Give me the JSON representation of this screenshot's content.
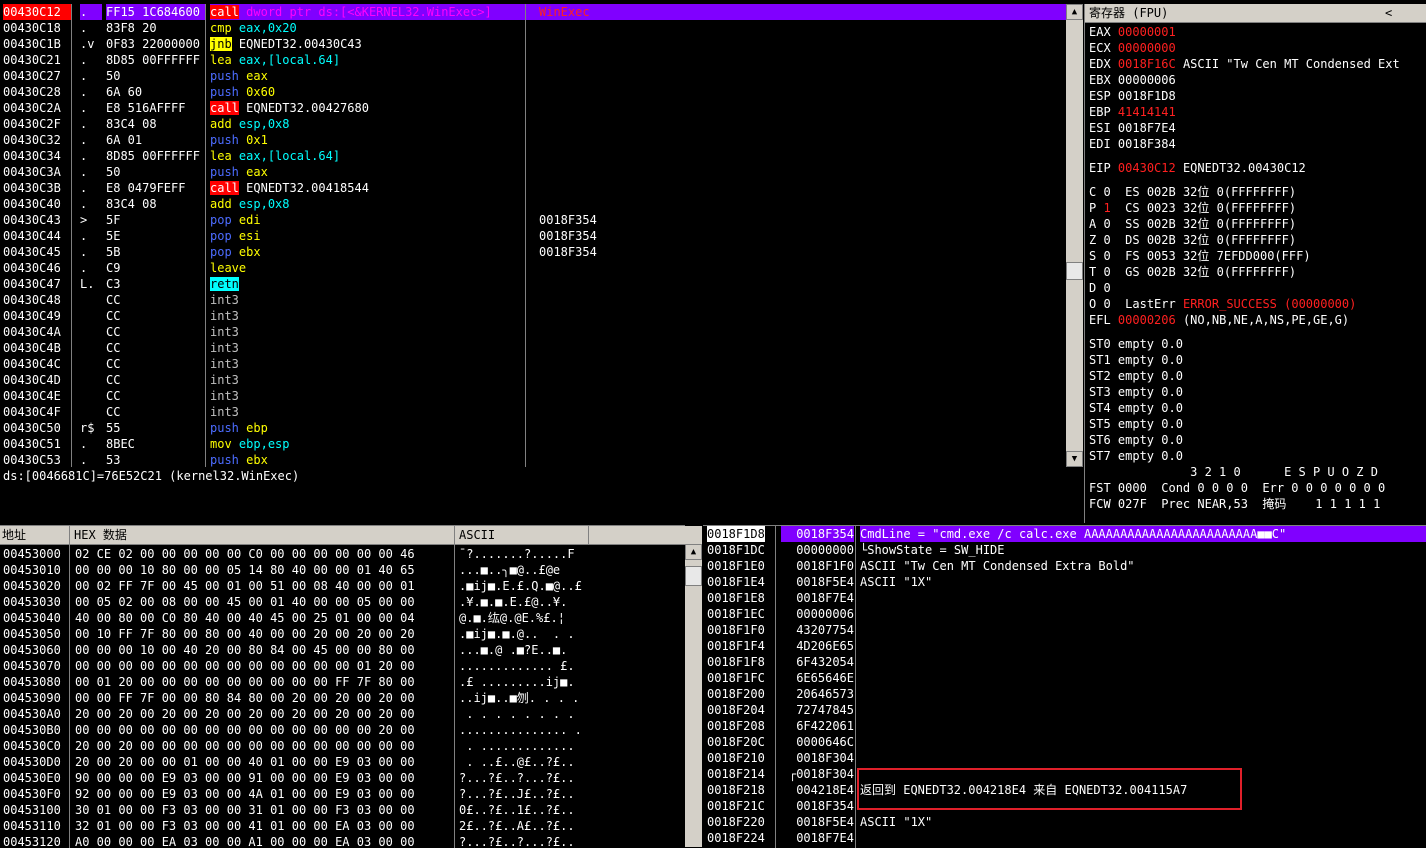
{
  "colors": {
    "select": "#8000ff",
    "call": "#ff0000",
    "jump": "#ffff00",
    "ret": "#00ffff",
    "push": "#4c6cff",
    "annot": "#e0202a"
  },
  "disasm": {
    "rows": [
      {
        "addr": "00430C12",
        "mark": ".",
        "hex": "FF15 1C684600",
        "parts": [
          [
            "call",
            "call"
          ],
          [
            "sp",
            " "
          ],
          [
            "sel",
            "dword ptr ds:[<&KERNEL32.WinExec>]"
          ]
        ],
        "comment": "WinExec",
        "selected": true
      },
      {
        "addr": "00430C18",
        "mark": ".",
        "hex": "83F8 20",
        "parts": [
          [
            "op",
            "cmp"
          ],
          [
            "sp",
            " "
          ],
          [
            "arg",
            "eax,0x20"
          ]
        ],
        "comment": ""
      },
      {
        "addr": "00430C1B",
        "mark": ".v",
        "hex": "0F83 22000000",
        "parts": [
          [
            "jmp",
            "jnb"
          ],
          [
            "sp",
            " "
          ],
          [
            "lbl",
            "EQNEDT32.00430C43"
          ]
        ],
        "comment": ""
      },
      {
        "addr": "00430C21",
        "mark": ".",
        "hex": "8D85 00FFFFFF",
        "parts": [
          [
            "op",
            "lea"
          ],
          [
            "sp",
            " "
          ],
          [
            "arg",
            "eax,[local.64]"
          ]
        ],
        "comment": ""
      },
      {
        "addr": "00430C27",
        "mark": ".",
        "hex": "50",
        "parts": [
          [
            "push",
            "push"
          ],
          [
            "sp",
            " "
          ],
          [
            "arg2",
            "eax"
          ]
        ],
        "comment": ""
      },
      {
        "addr": "00430C28",
        "mark": ".",
        "hex": "6A 60",
        "parts": [
          [
            "push",
            "push"
          ],
          [
            "sp",
            " "
          ],
          [
            "arg2",
            "0x60"
          ]
        ],
        "comment": ""
      },
      {
        "addr": "00430C2A",
        "mark": ".",
        "hex": "E8 516AFFFF",
        "parts": [
          [
            "call",
            "call"
          ],
          [
            "sp",
            " "
          ],
          [
            "lbl",
            "EQNEDT32.00427680"
          ]
        ],
        "comment": ""
      },
      {
        "addr": "00430C2F",
        "mark": ".",
        "hex": "83C4 08",
        "parts": [
          [
            "op",
            "add"
          ],
          [
            "sp",
            " "
          ],
          [
            "arg",
            "esp,0x8"
          ]
        ],
        "comment": ""
      },
      {
        "addr": "00430C32",
        "mark": ".",
        "hex": "6A 01",
        "parts": [
          [
            "push",
            "push"
          ],
          [
            "sp",
            " "
          ],
          [
            "arg2",
            "0x1"
          ]
        ],
        "comment": ""
      },
      {
        "addr": "00430C34",
        "mark": ".",
        "hex": "8D85 00FFFFFF",
        "parts": [
          [
            "op",
            "lea"
          ],
          [
            "sp",
            " "
          ],
          [
            "arg",
            "eax,[local.64]"
          ]
        ],
        "comment": ""
      },
      {
        "addr": "00430C3A",
        "mark": ".",
        "hex": "50",
        "parts": [
          [
            "push",
            "push"
          ],
          [
            "sp",
            " "
          ],
          [
            "arg2",
            "eax"
          ]
        ],
        "comment": ""
      },
      {
        "addr": "00430C3B",
        "mark": ".",
        "hex": "E8 0479FEFF",
        "parts": [
          [
            "call",
            "call"
          ],
          [
            "sp",
            " "
          ],
          [
            "lbl",
            "EQNEDT32.00418544"
          ]
        ],
        "comment": ""
      },
      {
        "addr": "00430C40",
        "mark": ".",
        "hex": "83C4 08",
        "parts": [
          [
            "op",
            "add"
          ],
          [
            "sp",
            " "
          ],
          [
            "arg",
            "esp,0x8"
          ]
        ],
        "comment": ""
      },
      {
        "addr": "00430C43",
        "mark": ">",
        "hex": "5F",
        "parts": [
          [
            "push",
            "pop"
          ],
          [
            "sp",
            " "
          ],
          [
            "arg2",
            "edi"
          ]
        ],
        "comment": "0018F354"
      },
      {
        "addr": "00430C44",
        "mark": ".",
        "hex": "5E",
        "parts": [
          [
            "push",
            "pop"
          ],
          [
            "sp",
            " "
          ],
          [
            "arg2",
            "esi"
          ]
        ],
        "comment": "0018F354"
      },
      {
        "addr": "00430C45",
        "mark": ".",
        "hex": "5B",
        "parts": [
          [
            "push",
            "pop"
          ],
          [
            "sp",
            " "
          ],
          [
            "arg2",
            "ebx"
          ]
        ],
        "comment": "0018F354"
      },
      {
        "addr": "00430C46",
        "mark": ".",
        "hex": "C9",
        "parts": [
          [
            "op",
            "leave"
          ]
        ],
        "comment": ""
      },
      {
        "addr": "00430C47",
        "mark": "L.",
        "hex": "C3",
        "parts": [
          [
            "ret",
            "retn"
          ]
        ],
        "comment": ""
      },
      {
        "addr": "00430C48",
        "mark": "",
        "hex": "CC",
        "parts": [
          [
            "int",
            "int3"
          ]
        ],
        "comment": ""
      },
      {
        "addr": "00430C49",
        "mark": "",
        "hex": "CC",
        "parts": [
          [
            "int",
            "int3"
          ]
        ],
        "comment": ""
      },
      {
        "addr": "00430C4A",
        "mark": "",
        "hex": "CC",
        "parts": [
          [
            "int",
            "int3"
          ]
        ],
        "comment": ""
      },
      {
        "addr": "00430C4B",
        "mark": "",
        "hex": "CC",
        "parts": [
          [
            "int",
            "int3"
          ]
        ],
        "comment": ""
      },
      {
        "addr": "00430C4C",
        "mark": "",
        "hex": "CC",
        "parts": [
          [
            "int",
            "int3"
          ]
        ],
        "comment": ""
      },
      {
        "addr": "00430C4D",
        "mark": "",
        "hex": "CC",
        "parts": [
          [
            "int",
            "int3"
          ]
        ],
        "comment": ""
      },
      {
        "addr": "00430C4E",
        "mark": "",
        "hex": "CC",
        "parts": [
          [
            "int",
            "int3"
          ]
        ],
        "comment": ""
      },
      {
        "addr": "00430C4F",
        "mark": "",
        "hex": "CC",
        "parts": [
          [
            "int",
            "int3"
          ]
        ],
        "comment": ""
      },
      {
        "addr": "00430C50",
        "mark": "r$",
        "hex": "55",
        "parts": [
          [
            "push",
            "push"
          ],
          [
            "sp",
            " "
          ],
          [
            "arg2",
            "ebp"
          ]
        ],
        "comment": ""
      },
      {
        "addr": "00430C51",
        "mark": ".",
        "hex": "8BEC",
        "parts": [
          [
            "op",
            "mov"
          ],
          [
            "sp",
            " "
          ],
          [
            "arg",
            "ebp,esp"
          ]
        ],
        "comment": ""
      },
      {
        "addr": "00430C53",
        "mark": ".",
        "hex": "53",
        "parts": [
          [
            "push",
            "push"
          ],
          [
            "sp",
            " "
          ],
          [
            "arg2",
            "ebx"
          ]
        ],
        "comment": ""
      }
    ]
  },
  "info_line": "ds:[0046681C]=76E52C21 (kernel32.WinExec)",
  "registers": {
    "title": "寄存器 (FPU)",
    "collapse": "<",
    "gp": [
      {
        "name": "EAX",
        "val": "00000001",
        "red": true,
        "note": ""
      },
      {
        "name": "ECX",
        "val": "00000000",
        "red": true,
        "note": ""
      },
      {
        "name": "EDX",
        "val": "0018F16C",
        "red": true,
        "note": "ASCII \"Tw Cen MT Condensed Ext"
      },
      {
        "name": "EBX",
        "val": "00000006",
        "red": false,
        "note": ""
      },
      {
        "name": "ESP",
        "val": "0018F1D8",
        "red": false,
        "note": ""
      },
      {
        "name": "EBP",
        "val": "41414141",
        "red": true,
        "note": ""
      },
      {
        "name": "ESI",
        "val": "0018F7E4",
        "red": false,
        "note": ""
      },
      {
        "name": "EDI",
        "val": "0018F384",
        "red": false,
        "note": ""
      }
    ],
    "eip": {
      "name": "EIP",
      "val": "00430C12",
      "note": "EQNEDT32.00430C12"
    },
    "flags": [
      {
        "f": "C",
        "v": "0",
        "red": false,
        "seg": "ES 002B 32位 0(FFFFFFFF)"
      },
      {
        "f": "P",
        "v": "1",
        "red": true,
        "seg": "CS 0023 32位 0(FFFFFFFF)"
      },
      {
        "f": "A",
        "v": "0",
        "red": false,
        "seg": "SS 002B 32位 0(FFFFFFFF)"
      },
      {
        "f": "Z",
        "v": "0",
        "red": false,
        "seg": "DS 002B 32位 0(FFFFFFFF)"
      },
      {
        "f": "S",
        "v": "0",
        "red": false,
        "seg": "FS 0053 32位 7EFDD000(FFF)"
      },
      {
        "f": "T",
        "v": "0",
        "red": false,
        "seg": "GS 002B 32位 0(FFFFFFFF)"
      },
      {
        "f": "D",
        "v": "0",
        "red": false,
        "seg": ""
      },
      {
        "f": "O",
        "v": "0",
        "red": false,
        "seg": "LastErr"
      }
    ],
    "lasterr": "ERROR_SUCCESS (00000000)",
    "efl": {
      "name": "EFL",
      "val": "00000206",
      "note": "(NO,NB,NE,A,NS,PE,GE,G)"
    },
    "st": [
      "ST0 empty 0.0",
      "ST1 empty 0.0",
      "ST2 empty 0.0",
      "ST3 empty 0.0",
      "ST4 empty 0.0",
      "ST5 empty 0.0",
      "ST6 empty 0.0",
      "ST7 empty 0.0"
    ],
    "fpu_hdr": "              3 2 1 0      E S P U O Z D",
    "fst": "FST 0000  Cond 0 0 0 0  Err 0 0 0 0 0 0 0",
    "fcw": "FCW 027F  Prec NEAR,53  掩码    1 1 1 1 1"
  },
  "dump": {
    "h_addr": "地址",
    "h_hex": "HEX 数据",
    "h_ascii": "ASCII",
    "rows": [
      [
        "00453000",
        "02 CE 02 00 00 00 00 00 C0 00 00 00 00 00 00 46",
        "¯?.......?.....F"
      ],
      [
        "00453010",
        "00 00 00 10 80 00 00 05 14 80 40 00 00 01 40 65",
        "...■..╮■@..£@e"
      ],
      [
        "00453020",
        "00 02 FF 7F 00 45 00 01 00 51 00 08 40 00 00 01",
        ".■ij■.E.£.Q.■@..£"
      ],
      [
        "00453030",
        "00 05 02 00 08 00 00 45 00 01 40 00 00 05 00 00",
        ".¥.■.■.E.£@..¥."
      ],
      [
        "00453040",
        "40 00 80 00 C0 80 40 00 40 45 00 25 01 00 00 04",
        "@.■.纮@.@E.%£.¦"
      ],
      [
        "00453050",
        "00 10 FF 7F 80 00 80 00 40 00 00 20 00 20 00 20",
        ".■ij■.■.@..  . ."
      ],
      [
        "00453060",
        "00 00 00 10 00 40 20 00 80 84 00 45 00 00 80 00",
        "...■.@ .■?E..■."
      ],
      [
        "00453070",
        "00 00 00 00 00 00 00 00 00 00 00 00 00 01 20 00",
        "............. £."
      ],
      [
        "00453080",
        "00 01 20 00 00 00 00 00 00 00 00 00 FF 7F 80 00",
        ".£ .........ij■."
      ],
      [
        "00453090",
        "00 00 FF 7F 00 00 80 84 80 00 20 00 20 00 20 00",
        "..ij■..■刎. . . ."
      ],
      [
        "004530A0",
        "20 00 20 00 20 00 20 00 20 00 20 00 20 00 20 00",
        " . . . . . . . ."
      ],
      [
        "004530B0",
        "00 00 00 00 00 00 00 00 00 00 00 00 00 00 20 00",
        "............... ."
      ],
      [
        "004530C0",
        "20 00 20 00 00 00 00 00 00 00 00 00 00 00 00 00",
        " . ............."
      ],
      [
        "004530D0",
        "20 00 20 00 00 01 00 00 40 01 00 00 E9 03 00 00",
        " . ..£..@£..?£.."
      ],
      [
        "004530E0",
        "90 00 00 00 E9 03 00 00 91 00 00 00 E9 03 00 00",
        "?...?£..?...?£.."
      ],
      [
        "004530F0",
        "92 00 00 00 E9 03 00 00 4A 01 00 00 E9 03 00 00",
        "?...?£..J£..?£.."
      ],
      [
        "00453100",
        "30 01 00 00 F3 03 00 00 31 01 00 00 F3 03 00 00",
        "0£..?£..1£..?£.."
      ],
      [
        "00453110",
        "32 01 00 00 F3 03 00 00 41 01 00 00 EA 03 00 00",
        "2£..?£..A£..?£.."
      ],
      [
        "00453120",
        "A0 00 00 00 EA 03 00 00 A1 00 00 00 EA 03 00 00",
        "?...?£..?...?£.."
      ]
    ]
  },
  "stack": {
    "rows": [
      [
        "0018F1D8",
        "0018F354",
        "CmdLine = \"cmd.exe /c calc.exe AAAAAAAAAAAAAAAAAAAAAAAA■■C\"",
        true
      ],
      [
        "0018F1DC",
        "00000000",
        "└ShowState = SW_HIDE",
        false
      ],
      [
        "0018F1E0",
        "0018F1F0",
        "ASCII \"Tw Cen MT Condensed Extra Bold\"",
        false
      ],
      [
        "0018F1E4",
        "0018F5E4",
        "ASCII \"1X\"",
        false
      ],
      [
        "0018F1E8",
        "0018F7E4",
        "",
        false
      ],
      [
        "0018F1EC",
        "00000006",
        "",
        false
      ],
      [
        "0018F1F0",
        "43207754",
        "",
        false
      ],
      [
        "0018F1F4",
        "4D206E65",
        "",
        false
      ],
      [
        "0018F1F8",
        "6F432054",
        "",
        false
      ],
      [
        "0018F1FC",
        "6E65646E",
        "",
        false
      ],
      [
        "0018F200",
        "20646573",
        "",
        false
      ],
      [
        "0018F204",
        "72747845",
        "",
        false
      ],
      [
        "0018F208",
        "6F422061",
        "",
        false
      ],
      [
        "0018F20C",
        "0000646C",
        "",
        false
      ],
      [
        "0018F210",
        "0018F304",
        "",
        false
      ],
      [
        "0018F214",
        "┌0018F304",
        "",
        false
      ],
      [
        "0018F218",
        "004218E4",
        "返回到 EQNEDT32.004218E4 来自 EQNEDT32.004115A7",
        false
      ],
      [
        "0018F21C",
        "0018F354",
        "",
        false
      ],
      [
        "0018F220",
        "0018F5E4",
        "ASCII \"1X\"",
        false
      ],
      [
        "0018F224",
        "0018F7E4",
        "",
        false
      ]
    ]
  }
}
